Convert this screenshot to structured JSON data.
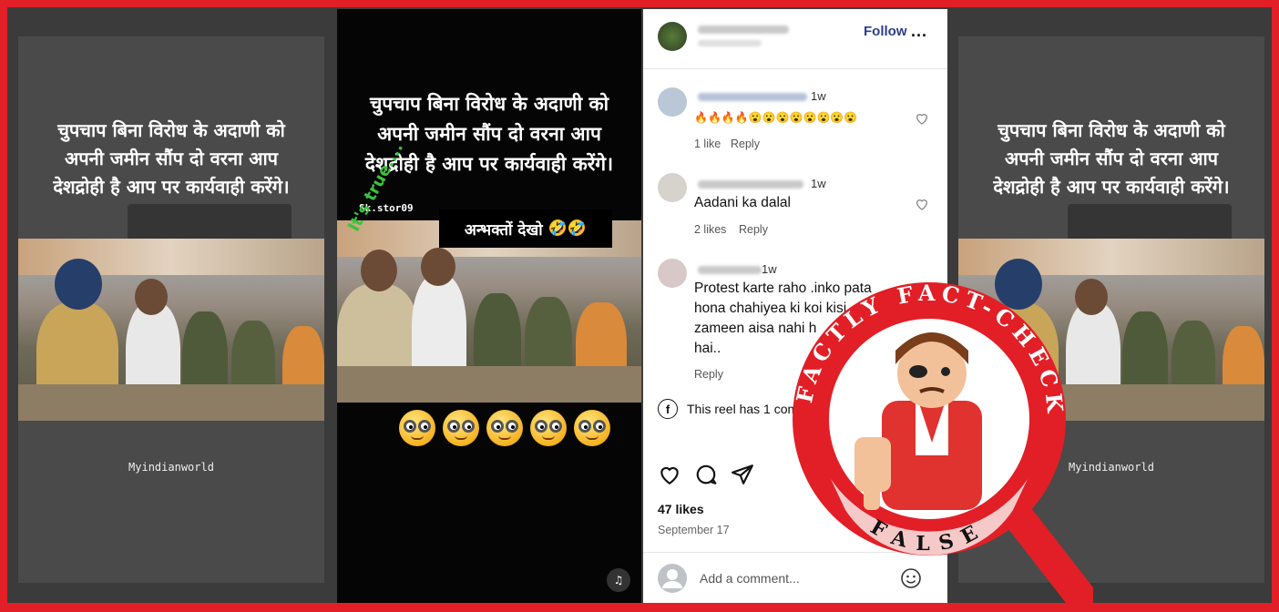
{
  "side_panel": {
    "caption_lines": [
      "चुपचाप बिना विरोध के अदाणी को",
      "अपनी जमीन सौंप दो वरना आप",
      "देशद्रोही है आप पर कार्यवाही करेंगे।"
    ],
    "handle": "Myindianworld"
  },
  "video": {
    "caption_lines": [
      "चुपचाप बिना विरोध के अदाणी को",
      "अपनी जमीन सौंप दो वरना आप",
      "देशद्रोही है आप पर कार्यवाही करेंगे।"
    ],
    "watermark": "Sk.stor09",
    "overlay_text": "It's true....",
    "label": "अन्भक्तों देखो",
    "label_emoji": "🤣🤣"
  },
  "post": {
    "follow_label": "Follow",
    "more_label": "...",
    "comments": [
      {
        "time": "1w",
        "text": "🔥🔥🔥🔥😮😮😮😮😮😮😮😮",
        "likes": "1 like",
        "reply": "Reply"
      },
      {
        "time": "1w",
        "text": "Aadani ka dalal",
        "likes": "2 likes",
        "reply": "Reply"
      },
      {
        "time": "1w",
        "text_lines": [
          "Protest karte raho .inko pata",
          "hona chahiyea ki koi kisi",
          "zameen aisa nahi h",
          "hai.."
        ],
        "reply": "Reply"
      }
    ],
    "fb_note": "This reel has 1 comment from Faceb",
    "likes_count": "47 likes",
    "date": "September 17",
    "add_comment_placeholder": "Add a comment..."
  },
  "stamp": {
    "top_text": "FACTLY FACT-CHECK",
    "verdict": "FALSE",
    "colors": {
      "red": "#e21f26",
      "pink": "#f6c9c9"
    }
  }
}
